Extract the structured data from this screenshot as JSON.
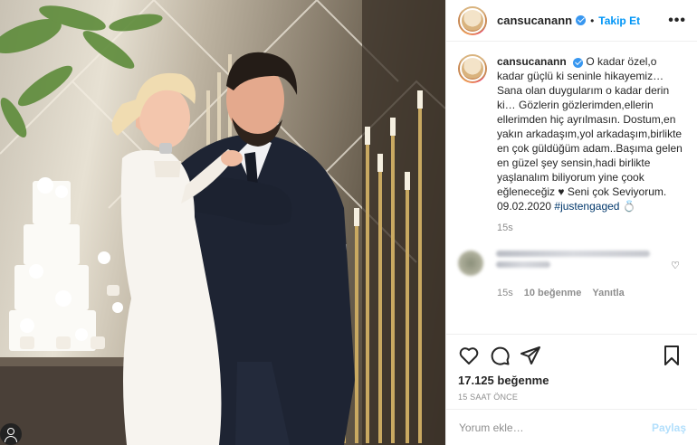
{
  "post": {
    "username": "cansucanann",
    "follow_label": "Takip Et",
    "dot": "•",
    "more_icon": "more-horizontal-icon",
    "verified_icon": "verified-badge-icon"
  },
  "caption": {
    "username": "cansucanann",
    "text": "O kadar özel,o kadar güçlü ki seninle hikayemiz…Sana olan duygularım o kadar derin ki… Gözlerin gözlerimden,ellerin ellerimden hiç ayrılmasın. Dostum,en yakın arkadaşım,yol arkadaşım,birlikte en çok güldüğüm adam..Başıma gelen en güzel şey sensin,hadi birlikte yaşlanalım biliyorum yine çook eğleneceğiz ♥ Seni çok Seviyorum. 09.02.2020",
    "hashtag": "#justengaged",
    "emoji": "💍",
    "time": "15s"
  },
  "comment": {
    "time": "15s",
    "likes": "10 beğenme",
    "reply": "Yanıtla",
    "like_icon": "heart-icon"
  },
  "actions": {
    "icons": [
      "heart-icon",
      "comment-icon",
      "share-icon",
      "bookmark-icon"
    ],
    "likes": "17.125 beğenme",
    "timestamp": "15 SAAT ÖNCE"
  },
  "add_comment": {
    "placeholder": "Yorum ekle…",
    "post_label": "Paylaş"
  }
}
